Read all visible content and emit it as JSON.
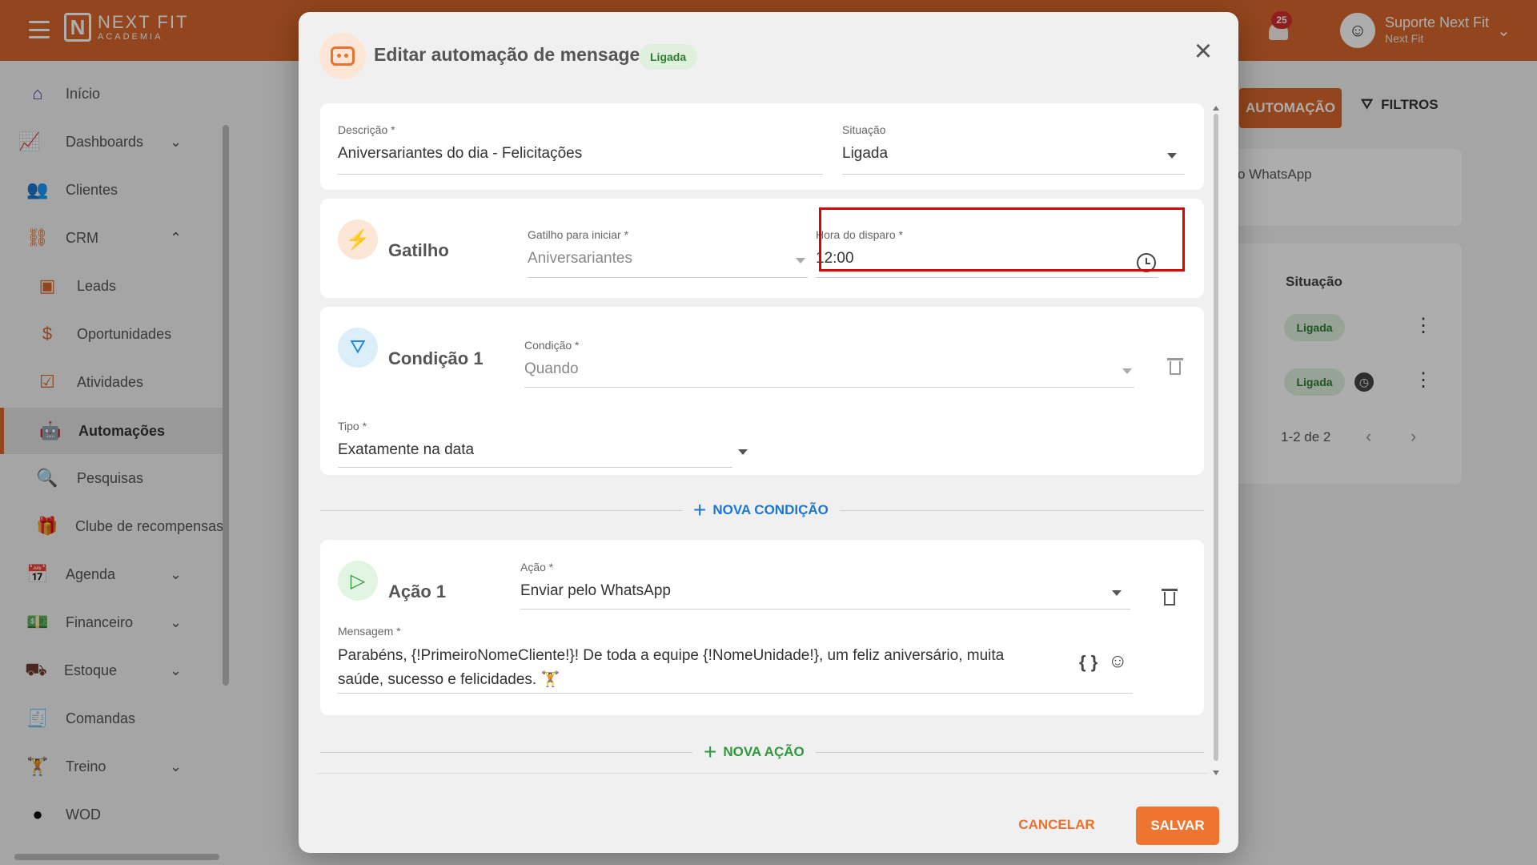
{
  "topbar": {
    "logo_line1": "NEXT FIT",
    "logo_line2": "ACADEMIA",
    "notifications_count": "25",
    "user_name": "Suporte Next Fit",
    "user_sub": "Next Fit",
    "accent_color": "#d9682b"
  },
  "sidebar": {
    "items": [
      {
        "label": "Início",
        "icon": "home-icon"
      },
      {
        "label": "Dashboards",
        "icon": "chart-line-icon"
      },
      {
        "label": "Clientes",
        "icon": "people-icon"
      },
      {
        "label": "CRM",
        "icon": "crm-icon"
      },
      {
        "label": "Leads",
        "icon": "contact-card-icon"
      },
      {
        "label": "Oportunidades",
        "icon": "money-bulb-icon"
      },
      {
        "label": "Atividades",
        "icon": "calendar-check-icon"
      },
      {
        "label": "Automações",
        "icon": "robot-icon"
      },
      {
        "label": "Pesquisas",
        "icon": "search-chart-icon"
      },
      {
        "label": "Clube de recompensas",
        "icon": "gift-icon"
      },
      {
        "label": "Agenda",
        "icon": "calendar-icon"
      },
      {
        "label": "Financeiro",
        "icon": "cash-icon"
      },
      {
        "label": "Estoque",
        "icon": "dolly-icon"
      },
      {
        "label": "Comandas",
        "icon": "receipt-icon"
      },
      {
        "label": "Treino",
        "icon": "dumbbell-icon"
      },
      {
        "label": "WOD",
        "icon": "kettlebell-icon"
      }
    ]
  },
  "background": {
    "new_automation_label": "AUTOMAÇÃO",
    "filters_label": "FILTROS",
    "card_text": "o WhatsApp",
    "status_header": "Situação",
    "row1_status": "Ligada",
    "row2_status": "Ligada",
    "pagination": "1-2 de 2"
  },
  "modal": {
    "title": "Editar automação de mensagens",
    "status_badge": "Ligada",
    "descricao_label": "Descrição *",
    "descricao_value": "Aniversariantes do dia - Felicitações",
    "situacao_label": "Situação",
    "situacao_value": "Ligada",
    "gatilho": {
      "title": "Gatilho",
      "trigger_label": "Gatilho para iniciar *",
      "trigger_value": "Aniversariantes",
      "time_label": "Hora do disparo *",
      "time_value": "12:00"
    },
    "condicao": {
      "title": "Condição 1",
      "cond_label": "Condição *",
      "cond_value": "Quando",
      "tipo_label": "Tipo *",
      "tipo_value": "Exatamente na data"
    },
    "nova_condicao": "NOVA CONDIÇÃO",
    "acao": {
      "title": "Ação 1",
      "acao_label": "Ação *",
      "acao_value": "Enviar pelo WhatsApp",
      "mensagem_label": "Mensagem *",
      "mensagem_line1": "Parabéns, {!PrimeiroNomeCliente!}! De toda a equipe {!NomeUnidade!}, um feliz aniversário, muita",
      "mensagem_line2": "saúde, sucesso e felicidades. 🏋️"
    },
    "nova_acao": "NOVA AÇÃO",
    "cancel_label": "CANCELAR",
    "save_label": "SALVAR",
    "colors": {
      "primary": "#ee7530",
      "link_blue": "#1976d2",
      "link_green": "#2e9a3c",
      "highlight": "#e00000"
    }
  }
}
